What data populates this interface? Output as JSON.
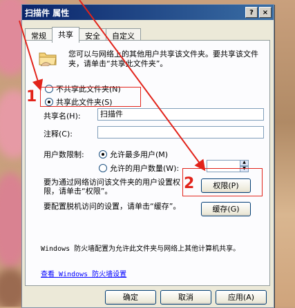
{
  "dialog": {
    "title": "扫描件 属性",
    "help_btn": "?",
    "close_btn": "×"
  },
  "tabs": [
    {
      "label": "常规"
    },
    {
      "label": "共享"
    },
    {
      "label": "安全"
    },
    {
      "label": "自定义"
    }
  ],
  "sharing": {
    "description": "您可以与网络上的其他用户共享该文件夹。要共享该文件夹，请单击“共享此文件夹”。",
    "no_share_label": "不共享此文件夹(N)",
    "share_label": "共享此文件夹(S)",
    "share_name_label": "共享名(H):",
    "share_name_value": "扫描件",
    "comment_label": "注释(C):",
    "comment_value": "",
    "user_limit_label": "用户数限制:",
    "max_allowed_label": "允许最多用户(M)",
    "allowed_users_label": "允许的用户数量(W):",
    "allowed_users_value": "",
    "permissions_text": "要为通过网络访问该文件夹的用户设置权限，请单击“权限”。",
    "permissions_button": "权限(P)",
    "caching_text": "要配置脱机访问的设置，请单击“缓存”。",
    "caching_button": "缓存(G)",
    "firewall_text": "Windows 防火墙配置为允许此文件夹与网络上其他计算机共享。",
    "firewall_link": "查看 Windows 防火墙设置"
  },
  "footer": {
    "ok_button": "确定",
    "cancel_button": "取消",
    "apply_button": "应用(A)"
  },
  "annotations": {
    "step1": "1",
    "step2": "2",
    "color": "#e2231a"
  }
}
